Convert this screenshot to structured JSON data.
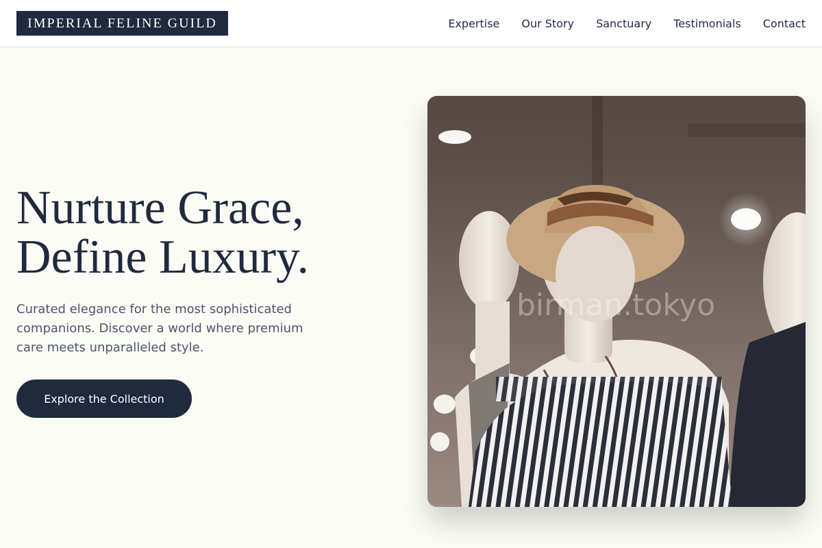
{
  "brand": {
    "logo_text": "IMPERIAL FELINE GUILD"
  },
  "nav": {
    "items": [
      {
        "label": "Expertise"
      },
      {
        "label": "Our Story"
      },
      {
        "label": "Sanctuary"
      },
      {
        "label": "Testimonials"
      },
      {
        "label": "Contact"
      }
    ]
  },
  "hero": {
    "title_line1": "Nurture Grace,",
    "title_line2": "Define Luxury.",
    "subtitle": "Curated elegance for the most sophisticated companions. Discover a world where premium care meets unparalleled style.",
    "cta_label": "Explore the Collection",
    "image_watermark": "birman.tokyo"
  },
  "colors": {
    "page_bg": "#fcfcf6",
    "primary_navy": "#1f2a3e",
    "body_text": "#4b5466",
    "header_bg": "#ffffff"
  }
}
